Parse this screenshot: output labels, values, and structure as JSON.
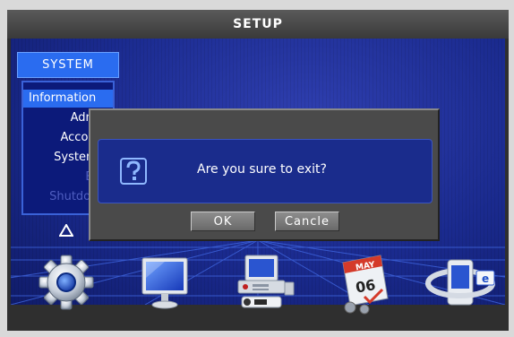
{
  "window": {
    "title": "SETUP"
  },
  "sidebar": {
    "header": "SYSTEM",
    "items": [
      {
        "label": "Information",
        "state": "selected"
      },
      {
        "label": "Admin",
        "state": "normal"
      },
      {
        "label": "Account",
        "state": "normal"
      },
      {
        "label": "System L",
        "state": "normal"
      },
      {
        "label": "Exit",
        "state": "disabled"
      },
      {
        "label": "Shutdown",
        "state": "disabled"
      }
    ],
    "scroll_icon": "up-triangle-icon"
  },
  "dialog": {
    "message": "Are you sure to exit?",
    "icon": "question-icon",
    "ok_label": "OK",
    "cancel_label": "Cancle"
  },
  "dock": {
    "icons": [
      "gear-icon",
      "monitor-icon",
      "computer-camera-icon",
      "calendar-icon",
      "network-browser-icon"
    ],
    "calendar_month": "MAY",
    "calendar_day": "06",
    "browser_badge": "e"
  },
  "colors": {
    "background_blue": "#1a2a8e",
    "highlight_blue": "#2a6cf0",
    "dialog_gray": "#4a4a4a"
  }
}
